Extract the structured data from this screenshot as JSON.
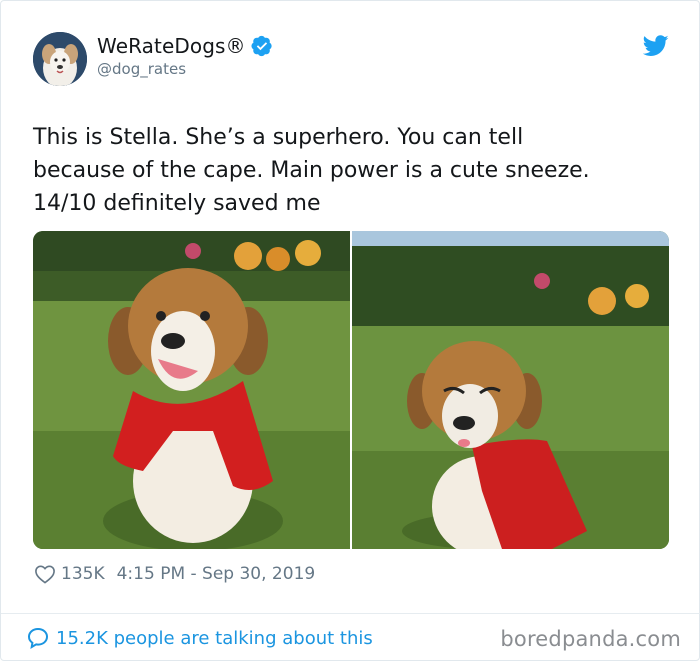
{
  "header": {
    "display_name": "WeRateDogs®",
    "handle": "@dog_rates",
    "avatar_icon": "dog-avatar",
    "verified_icon": "verified-badge-icon",
    "platform_icon": "twitter-bird-icon",
    "brand_color": "#1da1f2"
  },
  "tweet": {
    "text": "This is Stella. She’s a superhero. You can tell\nbecause of the cape. Main power is a cute sneeze.\n14/10 definitely saved me"
  },
  "media": {
    "photos": [
      "puppy-in-red-cape-smiling",
      "puppy-in-red-cape-sneezing"
    ]
  },
  "meta": {
    "like_icon": "heart-icon",
    "likes": "135K",
    "timestamp": "4:15 PM - Sep 30, 2019"
  },
  "footer": {
    "talking_icon": "speech-bubble-icon",
    "talking_text": "15.2K people are talking about this",
    "link_color": "#1b95e0",
    "watermark": "boredpanda.com"
  }
}
